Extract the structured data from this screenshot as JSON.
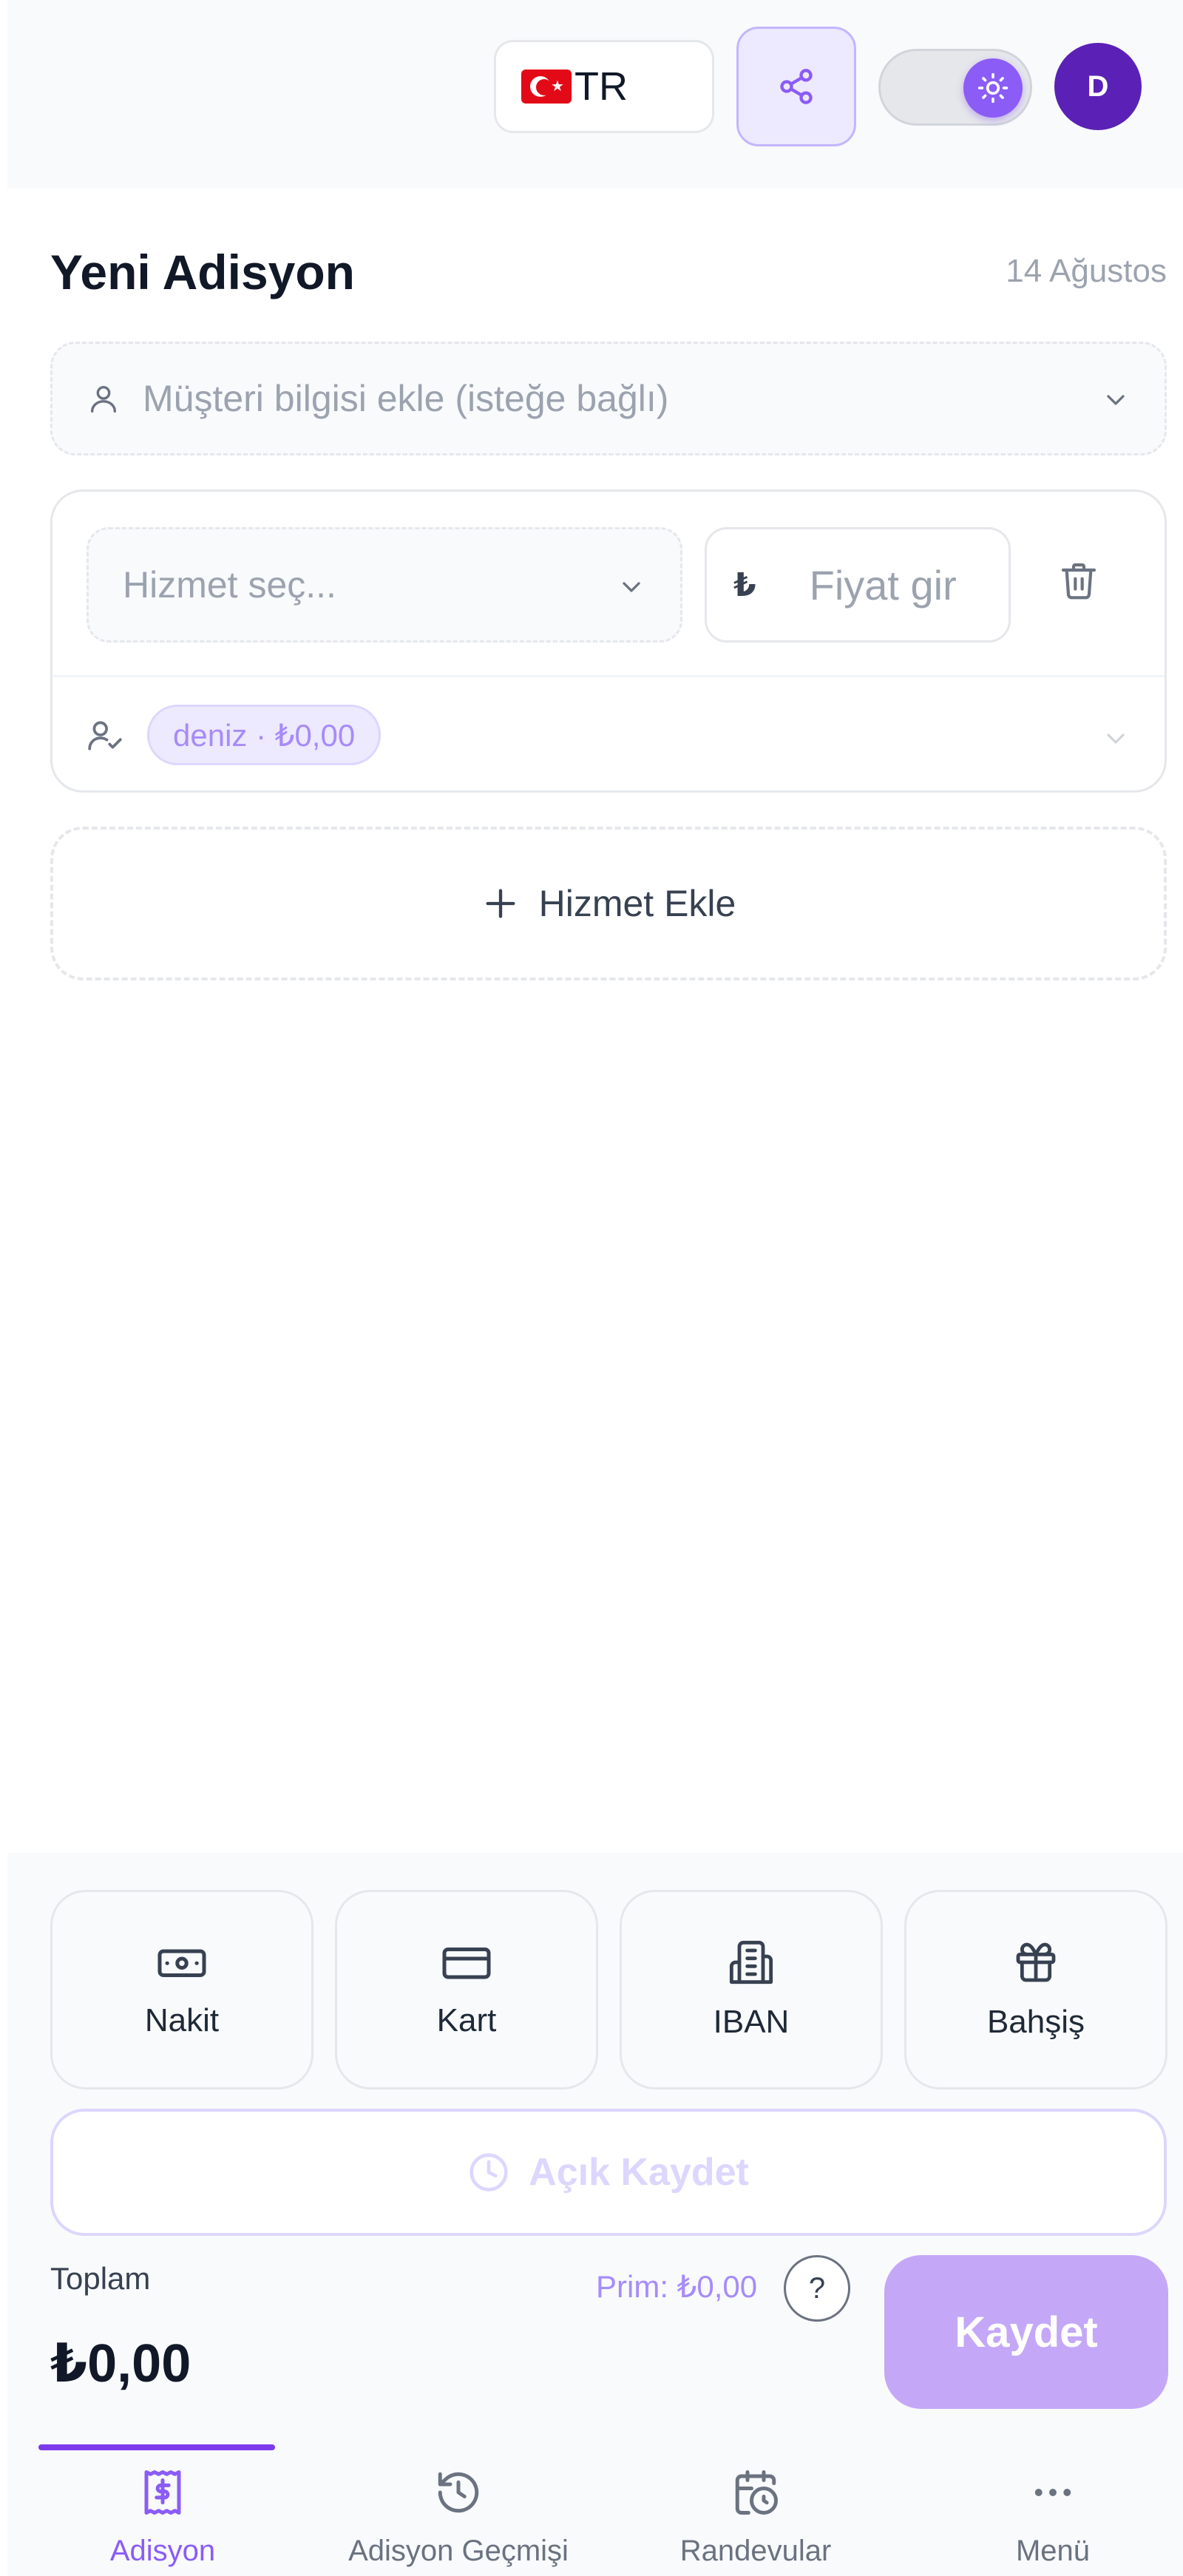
{
  "header": {
    "language": "TR",
    "avatar_initial": "D"
  },
  "page": {
    "title": "Yeni Adisyon",
    "date": "14 Ağustos"
  },
  "customer": {
    "placeholder": "Müşteri bilgisi ekle (isteğe bağlı)"
  },
  "service_row": {
    "service_placeholder": "Hizmet seç...",
    "currency_symbol": "₺",
    "price_placeholder": "Fiyat gir",
    "staff_chip": "deniz · ₺0,00"
  },
  "add_service_label": "Hizmet Ekle",
  "payment_methods": {
    "cash": "Nakit",
    "card": "Kart",
    "iban": "IBAN",
    "tip": "Bahşiş"
  },
  "open_save_label": "Açık Kaydet",
  "totals": {
    "label": "Toplam",
    "value": "₺0,00",
    "prim": "Prim: ₺0,00",
    "help": "?"
  },
  "save_label": "Kaydet",
  "nav": {
    "active": "Adisyon",
    "items": [
      "Adisyon",
      "Adisyon Geçmişi",
      "Randevular",
      "Menü"
    ]
  },
  "colors": {
    "accent": "#7c3aed",
    "accent_light": "#ede9fe",
    "muted_text": "#9ca3af"
  }
}
